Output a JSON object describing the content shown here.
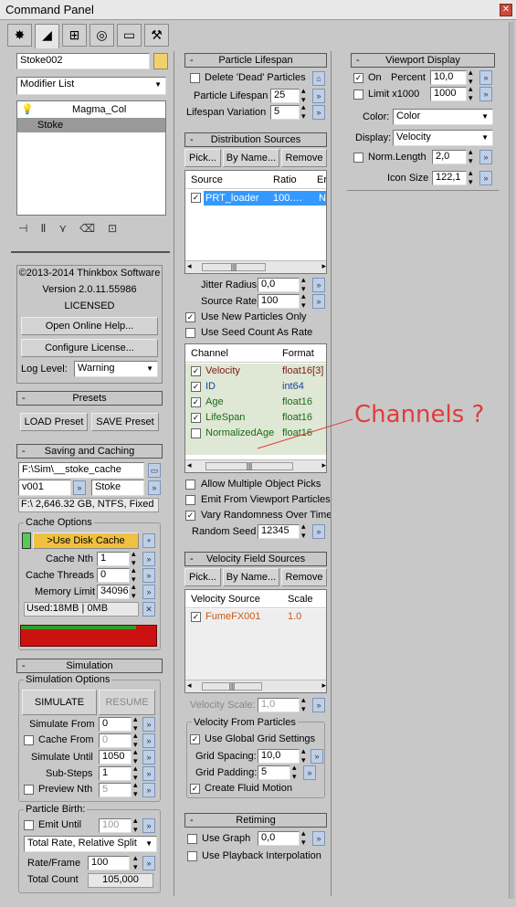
{
  "window": {
    "title": "Command Panel"
  },
  "tabs": [
    "create-icon",
    "modify-icon",
    "hierarchy-icon",
    "motion-icon",
    "display-icon",
    "utilities-icon"
  ],
  "object": {
    "name": "Stoke002",
    "modifier_list": "Modifier List",
    "stack": [
      "Magma_Col",
      "Stoke"
    ],
    "color": "#f2d16b"
  },
  "about": {
    "copyright": "©2013-2014 Thinkbox Software",
    "version": "Version 2.0.11.55986",
    "license": "LICENSED",
    "help_btn": "Open Online Help...",
    "license_btn": "Configure License...",
    "log_label": "Log Level:",
    "log_value": "Warning"
  },
  "presets": {
    "title": "Presets",
    "load": "LOAD Preset",
    "save": "SAVE Preset"
  },
  "saving": {
    "title": "Saving and Caching",
    "path": "F:\\Sim\\__stoke_cache",
    "version": "v001",
    "name": "Stoke",
    "disk": "F:\\ 2,646.32 GB, NTFS, Fixed",
    "cache_options": "Cache Options",
    "use_disk": ">Use Disk Cache",
    "cache_nth_label": "Cache Nth",
    "cache_nth": "1",
    "threads_label": "Cache Threads",
    "threads": "0",
    "mem_label": "Memory Limit",
    "mem": "34096",
    "used": "Used:18MB | 0MB"
  },
  "simulation": {
    "title": "Simulation",
    "options": "Simulation Options",
    "simulate": "SIMULATE",
    "resume": "RESUME",
    "from_label": "Simulate From",
    "from": "0",
    "cache_from_label": "Cache From",
    "cache_from": "0",
    "until_label": "Simulate Until",
    "until": "1050",
    "substeps_label": "Sub-Steps",
    "substeps": "1",
    "preview_label": "Preview Nth",
    "preview": "5",
    "birth": "Particle Birth:",
    "emit_label": "Emit Until",
    "emit": "100",
    "rate_mode": "Total Rate, Relative Split",
    "rate_label": "Rate/Frame",
    "rate": "100",
    "total_label": "Total Count",
    "total": "105,000"
  },
  "lifespan": {
    "title": "Particle Lifespan",
    "delete_dead": "Delete 'Dead' Particles",
    "life_label": "Particle Lifespan",
    "life": "25",
    "var_label": "Lifespan Variation",
    "var": "5"
  },
  "distribution": {
    "title": "Distribution Sources",
    "pick": "Pick...",
    "byname": "By Name...",
    "remove": "Remove",
    "cols": [
      "Source",
      "Ratio",
      "Er"
    ],
    "rows": [
      {
        "source": "PRT_loader",
        "ratio": "100.…",
        "er": "Ne"
      }
    ],
    "jitter_label": "Jitter Radius",
    "jitter": "0,0",
    "rate_label": "Source Rate",
    "rate": "100",
    "use_new": "Use New Particles Only",
    "seed_count": "Use Seed Count As Rate",
    "channel_cols": [
      "Channel",
      "Format"
    ],
    "channels": [
      {
        "name": "Velocity",
        "format": "float16[3]",
        "on": true
      },
      {
        "name": "ID",
        "format": "int64",
        "on": true
      },
      {
        "name": "Age",
        "format": "float16",
        "on": true
      },
      {
        "name": "LifeSpan",
        "format": "float16",
        "on": true
      },
      {
        "name": "NormalizedAge",
        "format": "float16",
        "on": false
      }
    ],
    "multi_pick": "Allow Multiple Object Picks",
    "emit_viewport": "Emit From Viewport Particles",
    "vary_random": "Vary Randomness Over Time",
    "seed_label": "Random Seed",
    "seed": "12345"
  },
  "velocity": {
    "title": "Velocity Field Sources",
    "pick": "Pick...",
    "byname": "By Name...",
    "remove": "Remove",
    "cols": [
      "Velocity Source",
      "Scale"
    ],
    "rows": [
      {
        "source": "FumeFX001",
        "scale": "1.0"
      }
    ],
    "scale_label": "Velocity Scale:",
    "scale": "1,0",
    "from_particles": "Velocity From Particles",
    "global_grid": "Use Global Grid Settings",
    "spacing_label": "Grid Spacing:",
    "spacing": "10,0",
    "padding_label": "Grid Padding:",
    "padding": "5",
    "fluid": "Create Fluid Motion"
  },
  "retiming": {
    "title": "Retiming",
    "use_graph": "Use Graph",
    "graph": "0,0",
    "playback": "Use Playback Interpolation"
  },
  "viewport": {
    "title": "Viewport Display",
    "on": "On",
    "percent_label": "Percent",
    "percent": "10,0",
    "limit": "Limit x1000",
    "limit_val": "1000",
    "color_label": "Color:",
    "color": "Color",
    "display_label": "Display:",
    "display": "Velocity",
    "norm_label": "Norm.Length",
    "norm": "2,0",
    "icon_label": "Icon Size",
    "icon": "122,1"
  },
  "annotation": {
    "text": "Channels ?",
    "color": "#e03c3c"
  },
  "colors": {
    "selected_row": "#3399ff",
    "use_disk": "#f0c040",
    "cache_bar": "#cc1111"
  }
}
